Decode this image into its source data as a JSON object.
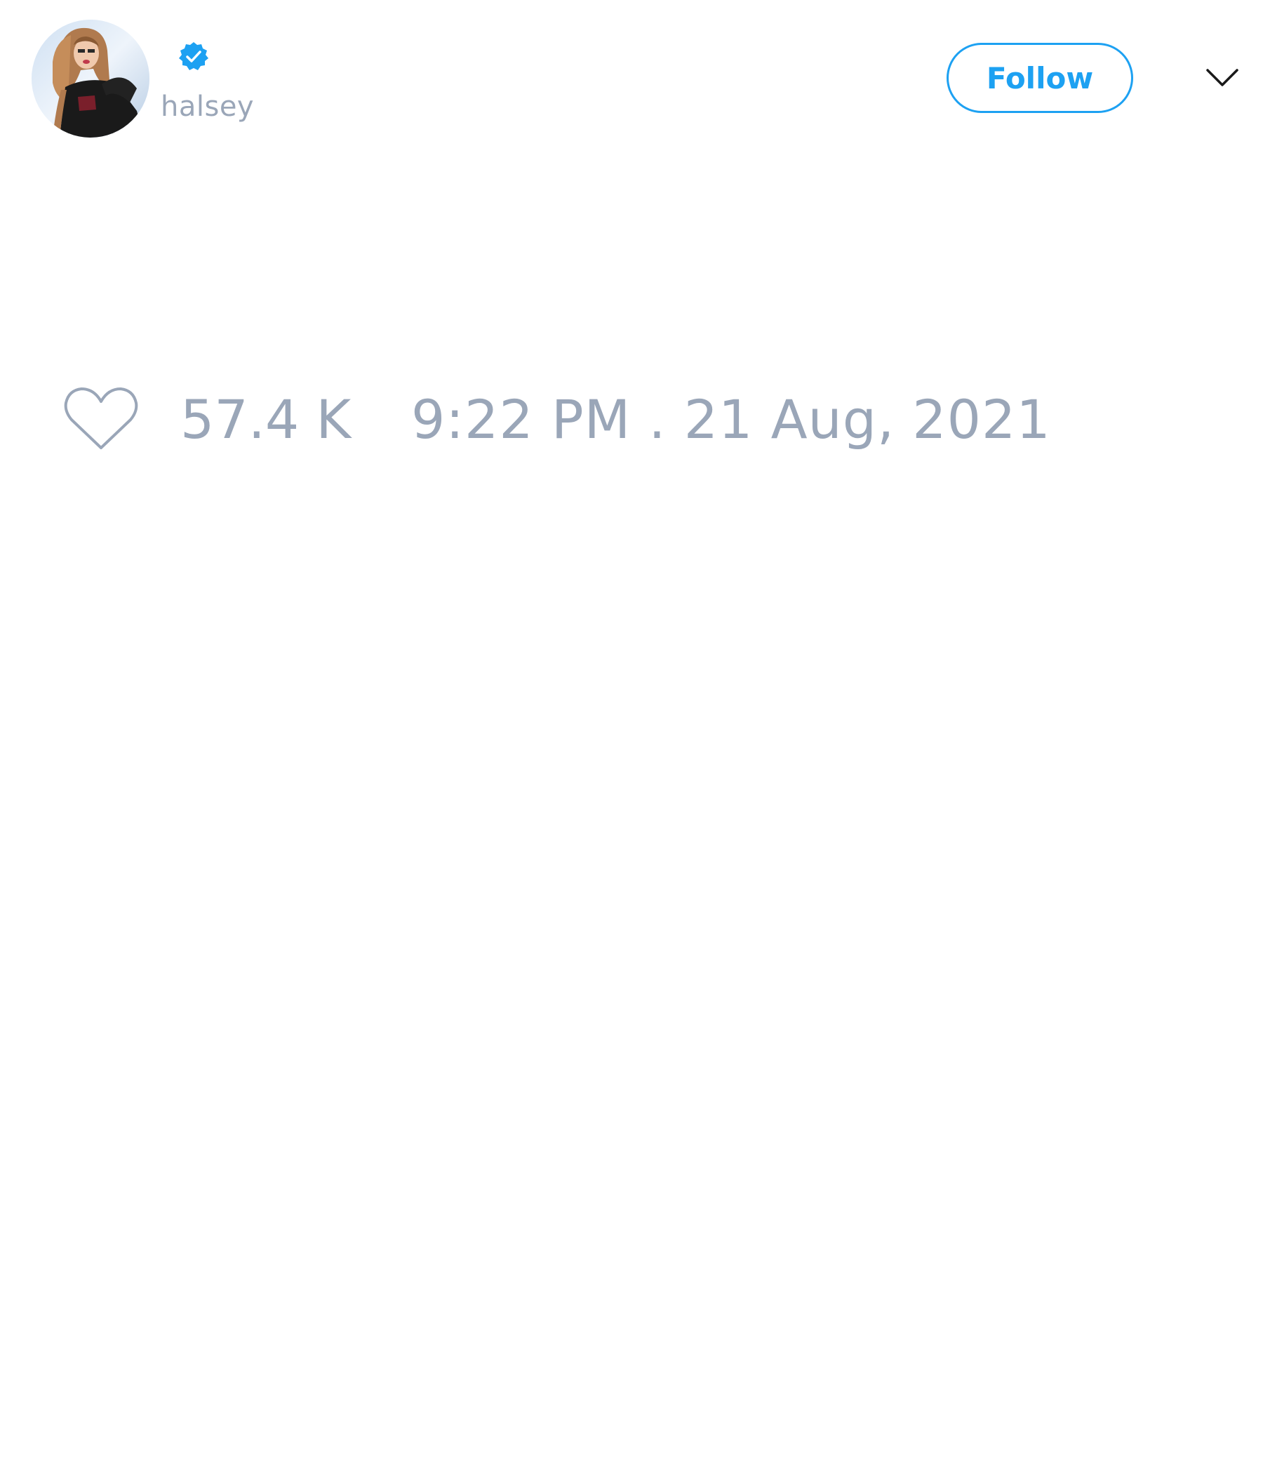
{
  "author": {
    "handle": "halsey",
    "verified": true,
    "avatar_icon": "profile-photo"
  },
  "actions": {
    "follow_label": "Follow",
    "more_icon": "chevron-down-icon"
  },
  "engagement": {
    "like_icon": "heart-outline-icon",
    "like_count": "57.4 K"
  },
  "timestamp": "9:22 PM . 21 Aug, 2021",
  "colors": {
    "accent": "#1da1f2",
    "muted_text": "#9aa6b8",
    "background": "#ffffff"
  }
}
